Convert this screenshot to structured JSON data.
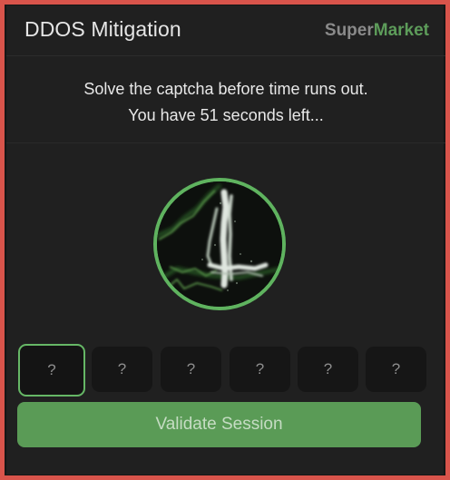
{
  "header": {
    "title": "DDOS Mitigation",
    "brand_part1": "Super",
    "brand_part2": "Market"
  },
  "instructions": {
    "line1": "Solve the captcha before time runs out.",
    "line2": "You have 51  seconds left..."
  },
  "captcha": {
    "icon": "captcha-image",
    "ring_color": "#5fb35f"
  },
  "code_inputs": [
    "?",
    "?",
    "?",
    "?",
    "?",
    "?"
  ],
  "validate_button": {
    "label": "Validate Session"
  },
  "colors": {
    "accent": "#5a9b56",
    "frame": "#d9544b",
    "panel": "#202020"
  }
}
